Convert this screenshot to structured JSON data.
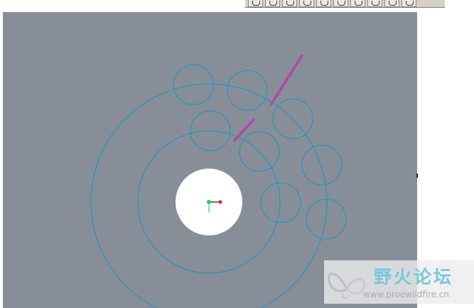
{
  "toolbar": {
    "buttons": [
      {
        "name": "zoom-window-button",
        "icon": "zoom-window-icon"
      },
      {
        "name": "zoom-in-button",
        "icon": "zoom-in-icon"
      },
      {
        "name": "zoom-out-button",
        "icon": "zoom-out-icon"
      },
      {
        "name": "refit-button",
        "icon": "refit-icon"
      },
      {
        "name": "view-orientation-button",
        "icon": "orientation-icon"
      },
      {
        "name": "saved-views-button",
        "icon": "saved-views-icon"
      },
      {
        "name": "display-style-button",
        "icon": "display-style-icon"
      },
      {
        "name": "datum-display-button",
        "icon": "datum-icon"
      },
      {
        "name": "spin-center-button",
        "icon": "spin-center-icon"
      },
      {
        "name": "annotation-display-button",
        "icon": "annotation-icon"
      }
    ]
  },
  "canvas": {
    "background_color": "#888e97",
    "sketch_color": "#1596c4",
    "highlight_color": "#a651a6",
    "solid_fill_color": "#ffffff",
    "origin_colors": {
      "x_axis": "#e02020",
      "y_axis": "#2ad1d1",
      "origin": "#28d62a"
    }
  },
  "watermark": {
    "title": "野火论坛",
    "url": "www.proewildfire.cn",
    "title_color": "#78c9d9"
  }
}
